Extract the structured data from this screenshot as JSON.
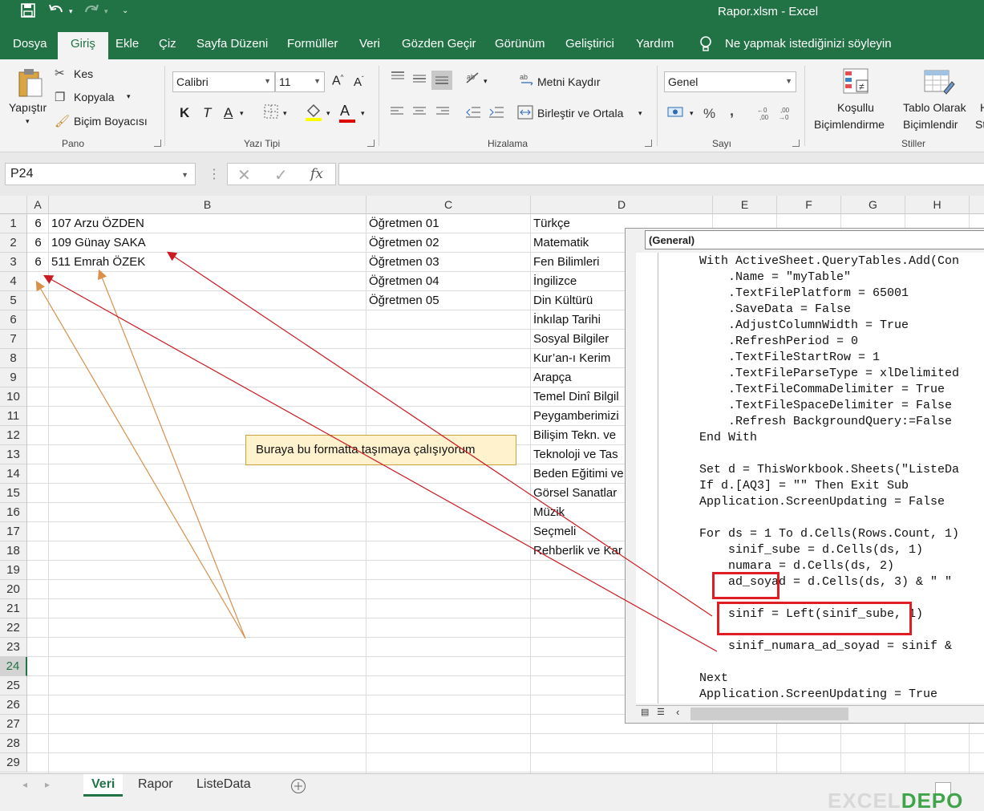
{
  "app": {
    "title": "Rapor.xlsm  -  Excel"
  },
  "menu": {
    "tabs": [
      "Dosya",
      "Giriş",
      "Ekle",
      "Çiz",
      "Sayfa Düzeni",
      "Formüller",
      "Veri",
      "Gözden Geçir",
      "Görünüm",
      "Geliştirici",
      "Yardım"
    ],
    "active": "Giriş",
    "tell_me": "Ne yapmak istediğinizi söyleyin"
  },
  "ribbon": {
    "clipboard": {
      "paste": "Yapıştır",
      "cut": "Kes",
      "copy": "Kopyala",
      "format_painter": "Biçim Boyacısı",
      "label": "Pano"
    },
    "font": {
      "name": "Calibri",
      "size": "11",
      "bold": "K",
      "italic": "T",
      "underline": "A",
      "color": "A",
      "label": "Yazı Tipi"
    },
    "alignment": {
      "wrap": "Metni Kaydır",
      "merge": "Birleştir ve Ortala",
      "label": "Hizalama"
    },
    "number": {
      "format": "Genel",
      "percent": "%",
      "comma": ",",
      "label": "Sayı"
    },
    "styles": {
      "conditional_1": "Koşullu",
      "conditional_2": "Biçimlendirme",
      "table_1": "Tablo Olarak",
      "table_2": "Biçimlendir",
      "label": "Stiller"
    }
  },
  "formula_bar": {
    "name_box": "P24",
    "fx": "fx",
    "formula": ""
  },
  "grid": {
    "columns": [
      "A",
      "B",
      "C",
      "D",
      "E",
      "F",
      "G",
      "H"
    ],
    "rows": [
      "1",
      "2",
      "3",
      "4",
      "5",
      "6",
      "7",
      "8",
      "9",
      "10",
      "11",
      "12",
      "13",
      "14",
      "15",
      "16",
      "17",
      "18",
      "19",
      "20",
      "21",
      "22",
      "23",
      "24",
      "25",
      "26",
      "27",
      "28",
      "29"
    ],
    "selected_row": "24",
    "col_a": [
      "6",
      "6",
      "6"
    ],
    "col_b": [
      "107 Arzu ÖZDEN",
      "109 Günay SAKA",
      "511 Emrah ÖZEK"
    ],
    "col_c": [
      "Öğretmen 01",
      "Öğretmen 02",
      "Öğretmen 03",
      "Öğretmen 04",
      "Öğretmen 05"
    ],
    "col_d": [
      "Türkçe",
      "Matematik",
      "Fen Bilimleri",
      "İngilizce",
      "Din Kültürü",
      "İnkılap Tarihi",
      "Sosyal Bilgiler",
      "Kur’an-ı Kerim",
      "Arapça",
      "Temel Dinî Bilgil",
      "Peygamberimizi",
      "Bilişim Tekn. ve",
      "Teknoloji ve Tas",
      "Beden Eğitimi ve",
      "Görsel Sanatlar",
      "Müzik",
      "Seçmeli",
      "Rehberlik ve Kar"
    ]
  },
  "callout": "Buraya bu formatta taşımaya çalışıyorum",
  "vba": {
    "combo": "(General)",
    "lines": [
      "With ActiveSheet.QueryTables.Add(Con",
      "    .Name = \"myTable\"",
      "    .TextFilePlatform = 65001",
      "    .SaveData = False",
      "    .AdjustColumnWidth = True",
      "    .RefreshPeriod = 0",
      "    .TextFileStartRow = 1",
      "    .TextFileParseType = xlDelimited",
      "    .TextFileCommaDelimiter = True",
      "    .TextFileSpaceDelimiter = False",
      "    .Refresh BackgroundQuery:=False",
      "End With",
      "",
      "Set d = ThisWorkbook.Sheets(\"ListeDa",
      "If d.[AQ3] = \"\" Then Exit Sub",
      "Application.ScreenUpdating = False",
      "",
      "For ds = 1 To d.Cells(Rows.Count, 1)",
      "    sinif_sube = d.Cells(ds, 1)",
      "    numara = d.Cells(ds, 2)",
      "    ad_soyad = d.Cells(ds, 3) & \" \"",
      "",
      "    sinif = Left(sinif_sube, 1)",
      "",
      "    sinif_numara_ad_soyad = sinif &",
      "",
      "Next",
      "Application.ScreenUpdating = True"
    ]
  },
  "sheets": {
    "tabs": [
      "Veri",
      "Rapor",
      "ListeData"
    ],
    "active": "Veri"
  },
  "watermark": {
    "part1": "EXCEL",
    "part2": "DEPO"
  }
}
